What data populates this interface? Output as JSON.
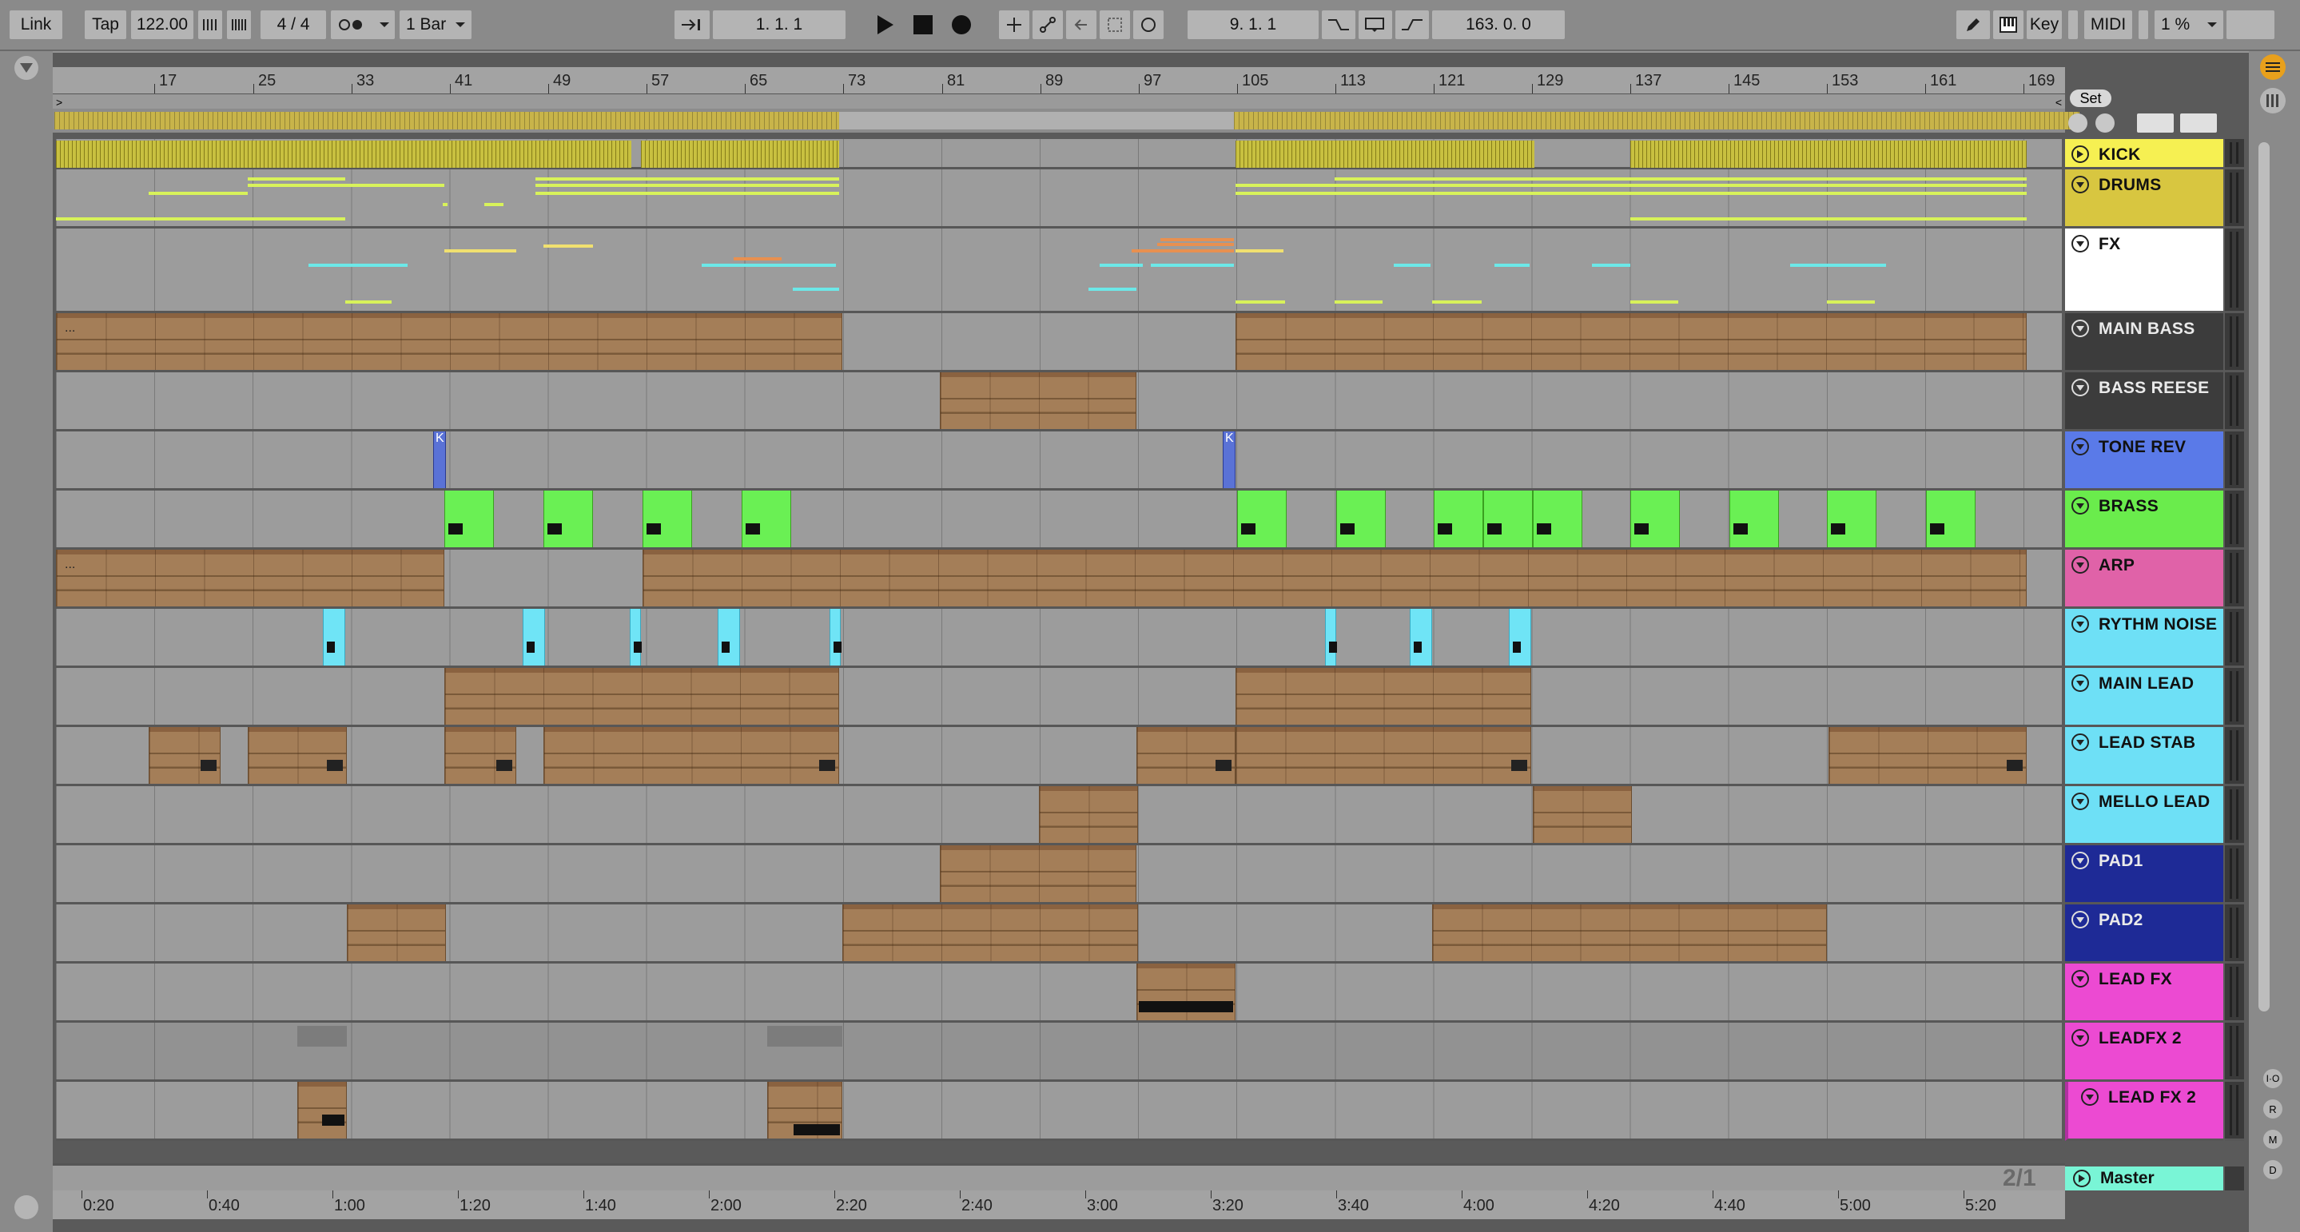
{
  "control_bar": {
    "link": "Link",
    "tap": "Tap",
    "tempo": "122.00",
    "signature": "4 / 4",
    "quantize": "1 Bar",
    "arrangement_position": "1.   1.   1",
    "loop_start": "9.   1.   1",
    "loop_length": "163.   0.   0",
    "key": "Key",
    "midi": "MIDI",
    "cpu": "1 %"
  },
  "ruler": {
    "bars": [
      "17",
      "25",
      "33",
      "41",
      "49",
      "57",
      "65",
      "73",
      "81",
      "89",
      "97",
      "105",
      "113",
      "121",
      "129",
      "137",
      "145",
      "153",
      "161",
      "169"
    ],
    "set": "Set"
  },
  "timeline": {
    "times": [
      "0:20",
      "0:40",
      "1:00",
      "1:20",
      "1:40",
      "2:00",
      "2:20",
      "2:40",
      "3:00",
      "3:20",
      "3:40",
      "4:00",
      "4:20",
      "4:40",
      "5:00",
      "5:20"
    ]
  },
  "tracks": [
    {
      "name": "KICK",
      "color": "#f6f052"
    },
    {
      "name": "DRUMS",
      "color": "#d8c640"
    },
    {
      "name": "FX",
      "color": "#ffffff"
    },
    {
      "name": "MAIN BASS",
      "color": "#3c3c3c"
    },
    {
      "name": "BASS REESE",
      "color": "#3c3c3c"
    },
    {
      "name": "TONE REV",
      "color": "#5a7ae8"
    },
    {
      "name": "BRASS",
      "color": "#6aec4c"
    },
    {
      "name": "ARP",
      "color": "#e062a8"
    },
    {
      "name": "RYTHM NOISE",
      "color": "#6ee0f6"
    },
    {
      "name": "MAIN LEAD",
      "color": "#6ee0f6"
    },
    {
      "name": "LEAD STAB",
      "color": "#6ee0f6"
    },
    {
      "name": "MELLO LEAD",
      "color": "#6ee0f6"
    },
    {
      "name": "PAD1",
      "color": "#1e2a96"
    },
    {
      "name": "PAD2",
      "color": "#1e2a96"
    },
    {
      "name": "LEAD FX",
      "color": "#ec4ad2"
    },
    {
      "name": "LEADFX 2",
      "color": "#ec4ad2"
    },
    {
      "name": "LEAD FX 2",
      "color": "#ec4ad2"
    }
  ],
  "master": "Master",
  "zoom_label": "2/1",
  "clip_labels": {
    "tone_rev_a": "K",
    "tone_rev_b": "K",
    "ellipsis": "..."
  },
  "icons": [
    "play-icon",
    "stop-icon",
    "record-icon",
    "pencil-icon",
    "piano-icon",
    "browser-icon"
  ]
}
